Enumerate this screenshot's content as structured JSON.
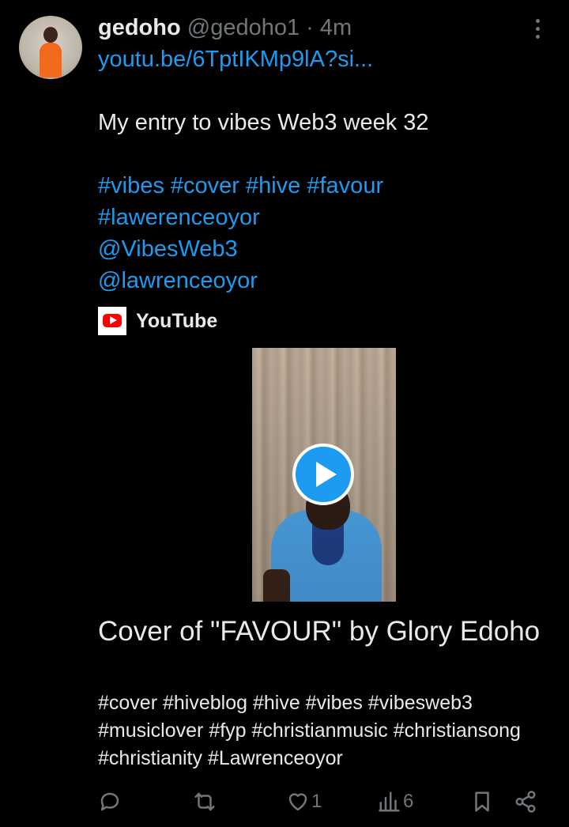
{
  "post": {
    "author_name": "gedoho",
    "author_handle": "@gedoho1",
    "separator": "·",
    "time": "4m",
    "link": "youtu.be/6TptIKMp9lA?si...",
    "text": "My entry to vibes Web3 week 32",
    "hashtags_line1": "#vibes #cover #hive #favour",
    "hashtags_line2": "#lawerenceoyor",
    "mention1": "@VibesWeb3",
    "mention2": "@lawrenceoyor"
  },
  "card": {
    "source": "YouTube",
    "title": "Cover of \"FAVOUR\" by Glory Edoho",
    "description": "#cover #hiveblog #hive #vibes #vibesweb3 #musiclover #fyp #christianmusic #christiansong #christianity #Lawrenceoyor"
  },
  "actions": {
    "likes": "1",
    "views": "6"
  },
  "icons": {
    "more": "more-vertical-icon",
    "reply": "reply-icon",
    "repost": "repost-icon",
    "like": "heart-icon",
    "views": "views-icon",
    "bookmark": "bookmark-icon",
    "share": "share-icon",
    "play": "play-icon",
    "youtube": "youtube-icon"
  },
  "colors": {
    "background": "#000000",
    "text": "#e7e9ea",
    "secondary": "#71767b",
    "link": "#1d9bf0",
    "youtube_red": "#ff0000"
  }
}
